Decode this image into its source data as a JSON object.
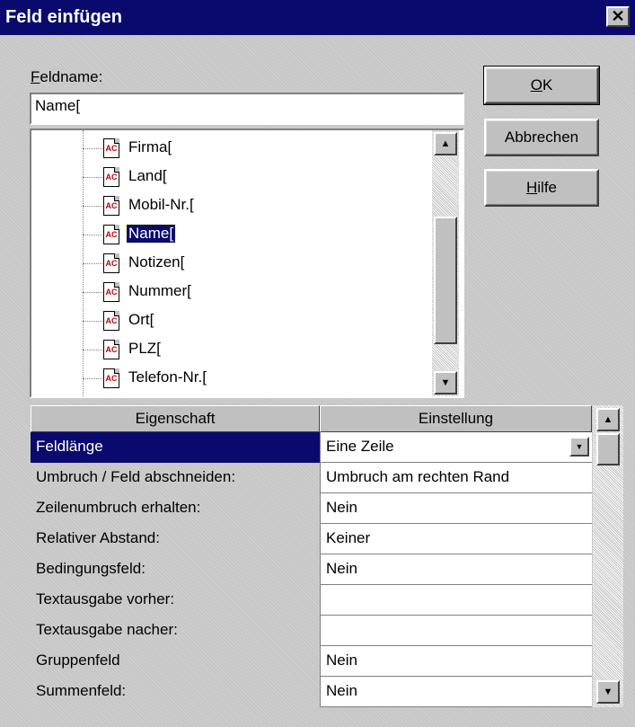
{
  "window": {
    "title": "Feld einfügen",
    "close_glyph": "✕"
  },
  "fieldname": {
    "label": "Feldname:",
    "value": "Name["
  },
  "buttons": {
    "ok": "OK",
    "cancel": "Abbrechen",
    "help": "Hilfe"
  },
  "tree": {
    "icon_text": "AC",
    "items": [
      {
        "label": "Firma[",
        "selected": false
      },
      {
        "label": "Land[",
        "selected": false
      },
      {
        "label": "Mobil-Nr.[",
        "selected": false
      },
      {
        "label": "Name[",
        "selected": true
      },
      {
        "label": "Notizen[",
        "selected": false
      },
      {
        "label": "Nummer[",
        "selected": false
      },
      {
        "label": "Ort[",
        "selected": false
      },
      {
        "label": "PLZ[",
        "selected": false
      },
      {
        "label": "Telefon-Nr.[",
        "selected": false
      }
    ]
  },
  "properties": {
    "headers": [
      "Eigenschaft",
      "Einstellung"
    ],
    "rows": [
      {
        "name": "Feldlänge",
        "value": "Eine Zeile",
        "selected": true,
        "dropdown": true
      },
      {
        "name": "Umbruch / Feld abschneiden:",
        "value": "Umbruch am rechten Rand"
      },
      {
        "name": "Zeilenumbruch erhalten:",
        "value": "Nein"
      },
      {
        "name": "Relativer Abstand:",
        "value": "Keiner"
      },
      {
        "name": "Bedingungsfeld:",
        "value": "Nein"
      },
      {
        "name": "Textausgabe vorher:",
        "value": ""
      },
      {
        "name": "Textausgabe nacher:",
        "value": ""
      },
      {
        "name": "Gruppenfeld",
        "value": "Nein"
      },
      {
        "name": "Summenfeld:",
        "value": "Nein"
      }
    ]
  },
  "colors": {
    "title_bar": "#0a0a6e",
    "selection": "#0a0a6e",
    "dialog_bg": "#c6c6c6"
  }
}
